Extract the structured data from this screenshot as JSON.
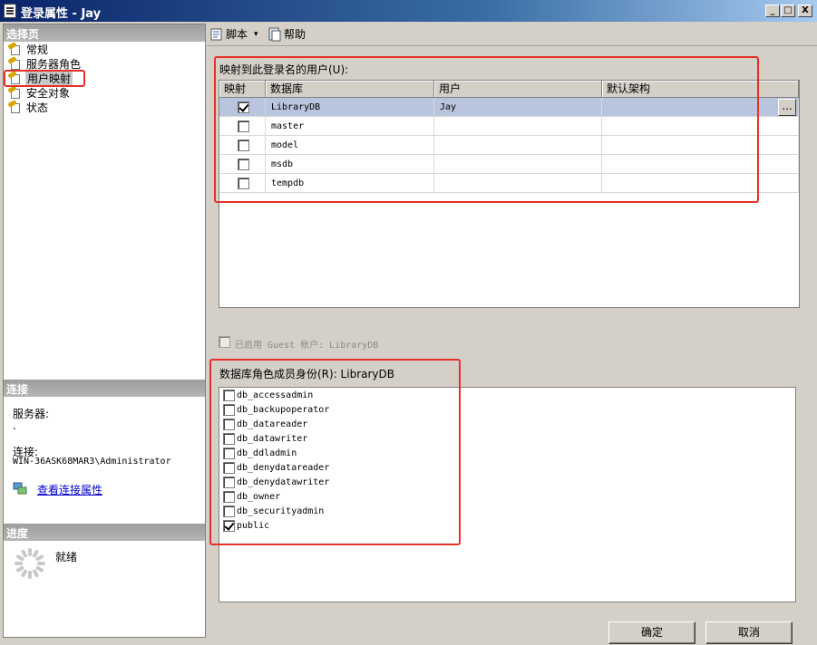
{
  "window": {
    "title": "登录属性 - Jay",
    "controls": {
      "minimize": "_",
      "maximize": "□",
      "close": "X"
    }
  },
  "sidebar": {
    "select_page_header": "选择页",
    "pages": [
      {
        "label": "常规",
        "icon": "page-wrench-icon"
      },
      {
        "label": "服务器角色",
        "icon": "page-wrench-icon"
      },
      {
        "label": "用户映射",
        "icon": "page-wrench-icon",
        "selected": true
      },
      {
        "label": "安全对象",
        "icon": "page-wrench-icon"
      },
      {
        "label": "状态",
        "icon": "page-wrench-icon"
      }
    ],
    "connection_header": "连接",
    "server_label": "服务器:",
    "server_value": ".",
    "connection_label": "连接:",
    "connection_value": "WIN-36ASK68MAR3\\Administrator",
    "view_connection_link": "查看连接属性",
    "progress_header": "进度",
    "progress_status": "就绪"
  },
  "toolbar": {
    "script_label": "脚本",
    "script_dropdown": "▾",
    "help_label": "帮助"
  },
  "mapping": {
    "group_label": "映射到此登录名的用户(U):",
    "columns": [
      "映射",
      "数据库",
      "用户",
      "默认架构"
    ],
    "rows": [
      {
        "mapped": true,
        "database": "LibraryDB",
        "user": "Jay",
        "schema": ""
      },
      {
        "mapped": false,
        "database": "master",
        "user": "",
        "schema": ""
      },
      {
        "mapped": false,
        "database": "model",
        "user": "",
        "schema": ""
      },
      {
        "mapped": false,
        "database": "msdb",
        "user": "",
        "schema": ""
      },
      {
        "mapped": false,
        "database": "tempdb",
        "user": "",
        "schema": ""
      }
    ],
    "ellipsis_label": "..."
  },
  "guest": {
    "label": "已启用 Guest 帐户: LibraryDB",
    "checked": false
  },
  "roles": {
    "group_label": "数据库角色成员身份(R): LibraryDB",
    "items": [
      {
        "name": "db_accessadmin",
        "checked": false
      },
      {
        "name": "db_backupoperator",
        "checked": false
      },
      {
        "name": "db_datareader",
        "checked": false
      },
      {
        "name": "db_datawriter",
        "checked": false
      },
      {
        "name": "db_ddladmin",
        "checked": false
      },
      {
        "name": "db_denydatareader",
        "checked": false
      },
      {
        "name": "db_denydatawriter",
        "checked": false
      },
      {
        "name": "db_owner",
        "checked": false
      },
      {
        "name": "db_securityadmin",
        "checked": false
      },
      {
        "name": "public",
        "checked": true
      }
    ]
  },
  "footer": {
    "ok_label": "确定",
    "cancel_label": "取消"
  },
  "colors": {
    "annotation": "#e8302a",
    "selection": "#b9c4de",
    "titlebar": "#0a246a"
  }
}
